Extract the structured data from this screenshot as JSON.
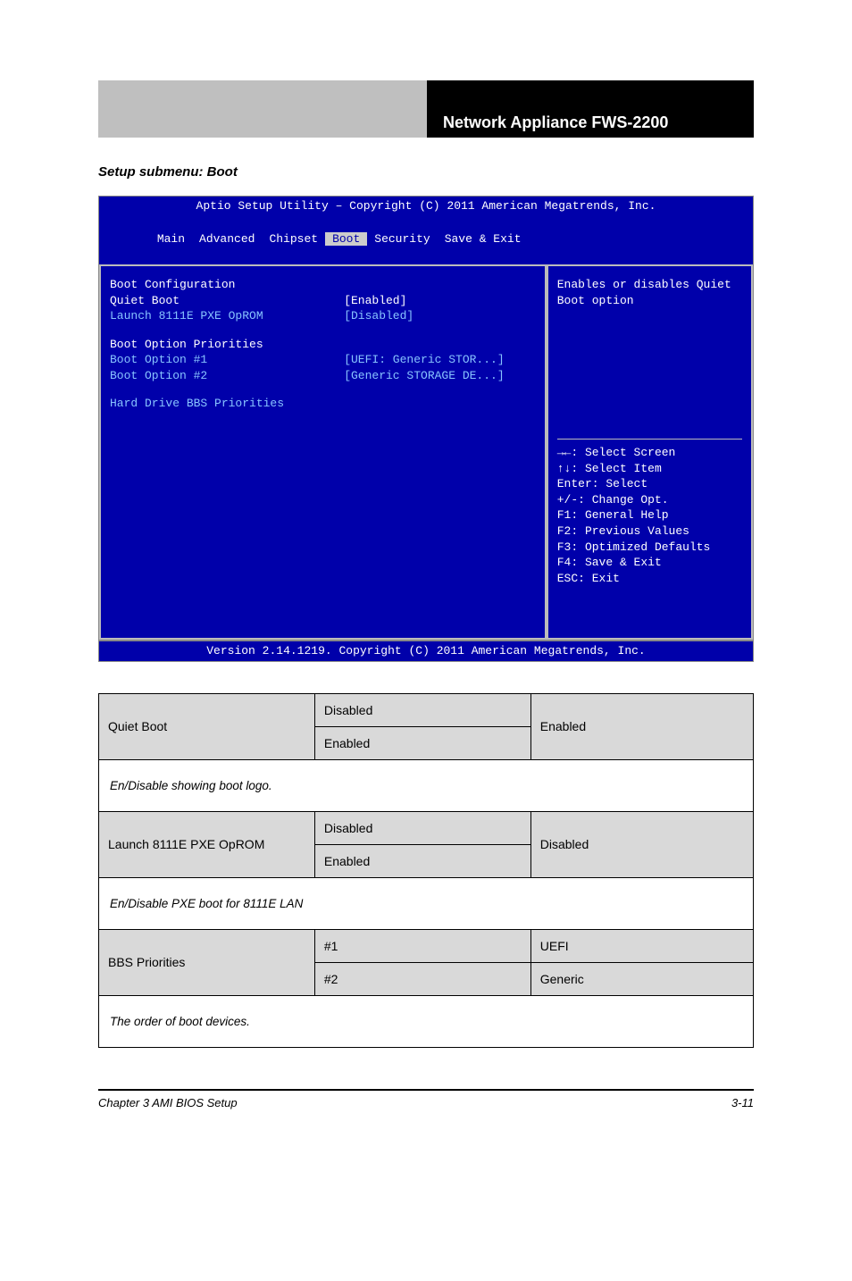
{
  "header": {
    "right": "Network Appliance FWS-2200"
  },
  "section_title": "Setup submenu: Boot",
  "bios": {
    "title": "Aptio Setup Utility – Copyright (C) 2011 American Megatrends, Inc.",
    "tabs": [
      "Main",
      "Advanced",
      "Chipset",
      "Boot",
      "Security",
      "Save & Exit"
    ],
    "tabs_active": "Boot",
    "left": {
      "heading1": "Boot Configuration",
      "quiet_boot_label": "Quiet Boot",
      "quiet_boot_value": "[Enabled]",
      "pxe_label": "Launch 8111E PXE OpROM",
      "pxe_value": "[Disabled]",
      "heading2": "Boot Option Priorities",
      "opt1_label": "Boot Option #1",
      "opt1_value": "[UEFI: Generic STOR...]",
      "opt2_label": "Boot Option #2",
      "opt2_value": "[Generic STORAGE DE...]",
      "bbs_label": "Hard Drive BBS Priorities"
    },
    "right": {
      "help_text": "Enables or disables Quiet Boot option",
      "keys": [
        "→←: Select Screen",
        "↑↓: Select Item",
        "Enter: Select",
        "+/-: Change Opt.",
        "F1: General Help",
        "F2: Previous Values",
        "F3: Optimized Defaults",
        "F4: Save & Exit",
        "ESC: Exit"
      ]
    },
    "footer": "Version 2.14.1219. Copyright (C) 2011 American Megatrends, Inc."
  },
  "table": {
    "row1": {
      "param": "Quiet Boot",
      "opts": [
        "Disabled",
        "Enabled"
      ],
      "default": "Enabled"
    },
    "desc1": "En/Disable showing boot logo.",
    "row2": {
      "param": "Launch 8111E PXE OpROM",
      "opts": [
        "Disabled",
        "Enabled"
      ],
      "default": "Disabled"
    },
    "desc2": "En/Disable PXE boot for 8111E LAN",
    "row3": {
      "param": "BBS Priorities",
      "opts": [
        "#1",
        "#2"
      ],
      "defaults": [
        "UEFI",
        "Generic"
      ]
    },
    "desc3": "The order of boot devices."
  },
  "footer": {
    "chapter": "Chapter 3 AMI BIOS Setup",
    "page": "3-11"
  }
}
